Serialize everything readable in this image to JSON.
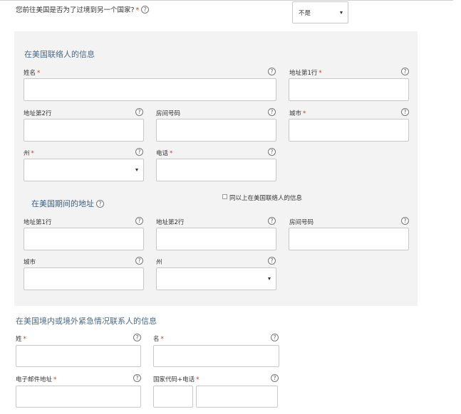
{
  "travel_question": {
    "text": "您前往美国是否为了过境到另一个国家?",
    "required_mark": "*",
    "answer": "不是"
  },
  "us_contact": {
    "title": "在美国联络人的信息",
    "name_label": "姓名",
    "address1_label": "地址第1行",
    "address2_label": "地址第2行",
    "apt_label": "房间号码",
    "city_label": "城市",
    "state_label": "州",
    "phone_label": "电话",
    "required_mark": "*"
  },
  "us_address": {
    "title": "在美国期间的地址",
    "same_checkbox_label": "同以上在美国联络人的信息",
    "address1_label": "地址第1行",
    "address2_label": "地址第2行",
    "apt_label": "房间号码",
    "city_label": "城市",
    "state_label": "州"
  },
  "emergency_contact": {
    "title": "在美国境内或境外紧急情况联系人的信息",
    "last_name_label": "姓",
    "first_name_label": "名",
    "email_label": "电子邮件地址",
    "phone_label": "国家代码+电话",
    "required_mark": "*"
  },
  "help_glyph": "?"
}
